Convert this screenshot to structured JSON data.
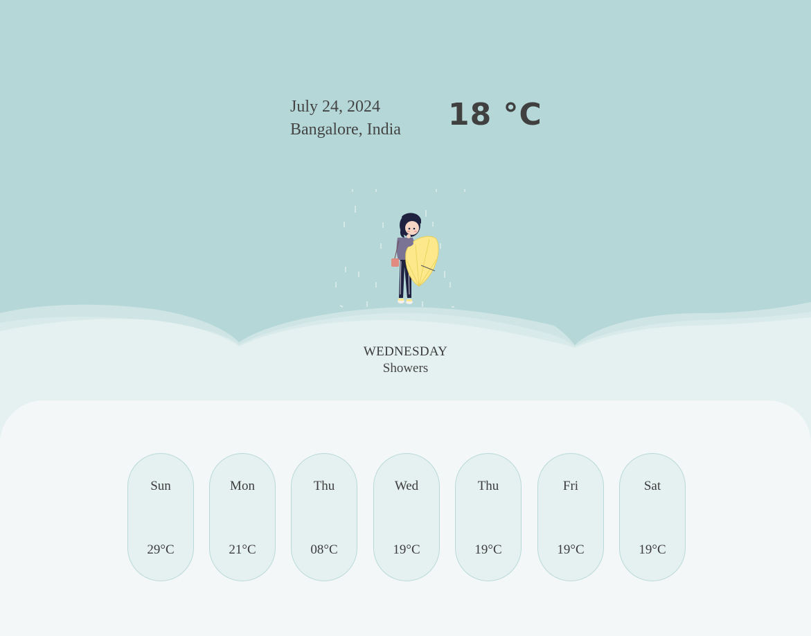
{
  "colors": {
    "sky": "#b5d7d8",
    "cloud_front": "#e5f1f0",
    "panel": "#f3f7f8",
    "card_fill": "#e5f1f0",
    "card_border": "#b9d9d8",
    "umbrella": "#fde98b"
  },
  "current": {
    "date": "July 24, 2024",
    "location": "Bangalore, India",
    "temperature": "18 °C",
    "day": "WEDNESDAY",
    "condition": "Showers",
    "illustration_icon": "girl-with-umbrella-in-rain-icon"
  },
  "forecast": [
    {
      "day": "Sun",
      "temp": "29°C"
    },
    {
      "day": "Mon",
      "temp": "21°C"
    },
    {
      "day": "Thu",
      "temp": "08°C"
    },
    {
      "day": "Wed",
      "temp": "19°C"
    },
    {
      "day": "Thu",
      "temp": "19°C"
    },
    {
      "day": "Fri",
      "temp": "19°C"
    },
    {
      "day": "Sat",
      "temp": "19°C"
    }
  ]
}
